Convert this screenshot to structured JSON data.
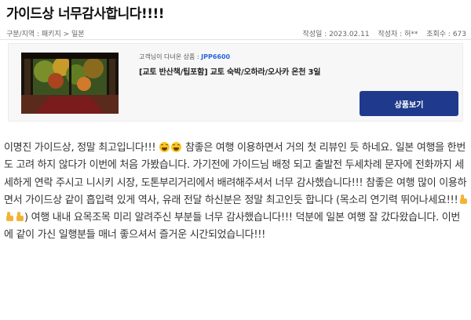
{
  "page": {
    "title": "가이드상 너무감사합니다!!!!",
    "breadcrumb": "구분/지역 : 패키지 > 일본",
    "date_label": "작성일 : 2023.02.11",
    "author_label": "작성자 : 허**",
    "views_label": "조회수 : 673"
  },
  "product": {
    "label_prefix": "고객님이 다녀온 상품 :",
    "code": "JPP6600",
    "name": "[교토 반산책/팁포함] 교토 숙박/오하라/오사카 온천 3일",
    "button_label": "상품보기",
    "image_icon": "japanese-garden-photo"
  },
  "review": {
    "seg1": "이명진 가이드상, 정말 최고입니다!!!",
    "seg2": "참좋은 여행 이용하면서 거의 첫 리뷰인 듯 하네요. 일본 여행을 한번도 고려 하지 않다가 이번에 처음 가봤습니다. 가기전에 가이드님 배정 되고 출발전 두세차례 문자에 전화까지 세세하게 연락 주시고 니시키 시장, 도톤부리거리에서 배려해주셔서 너무 감사했습니다!!! 참좋은 여행 많이 이용하면서 가이드상 같이 흡입력 있게 역사, 유래 전달 하신분은 정말 최고인듯 합니다 (목소리 연기력 뛰어나세요!!!",
    "seg3": ") 여행 내내 요목조목 미리 알려주신 부분들 너무 감사했습니다!!! 덕분에 일본 여행 잘 갔다왔습니다. 이번에 같이 가신 일행분들 매너 좋으셔서 즐거운 시간되었습니다!!!",
    "emoji_icons": [
      "grinning-squinting-face-icon",
      "thumbs-up-icon"
    ]
  }
}
